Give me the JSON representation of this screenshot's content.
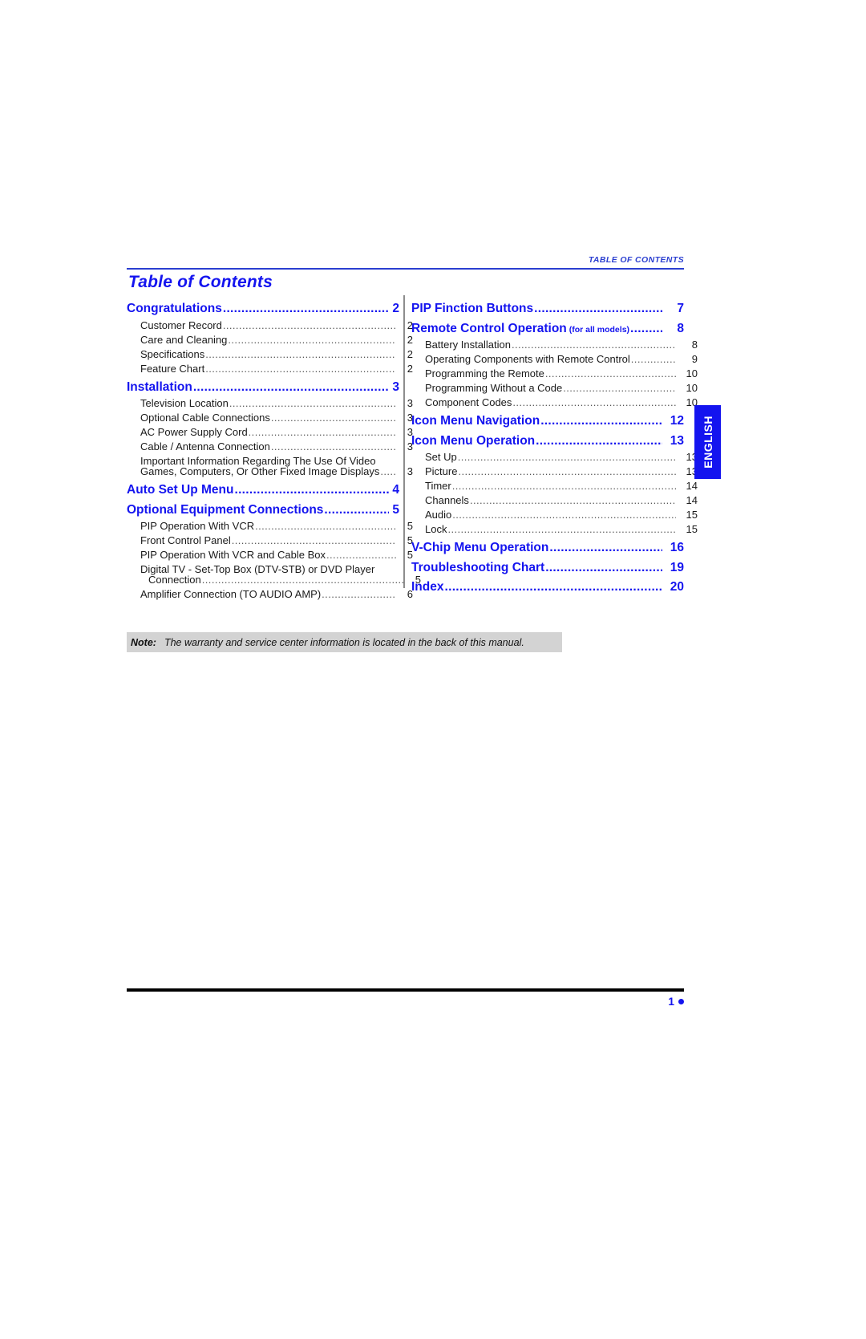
{
  "header": {
    "kicker_first": "T",
    "kicker_rest": "ABLE OF ",
    "kicker_c": "C",
    "kicker_tail": "ONTENTS",
    "kicker_full": "TABLE OF CONTENTS",
    "title": "Table of Contents"
  },
  "colors": {
    "heading_blue": "#1414ef",
    "kicker_blue": "#2b3fd0",
    "note_gray": "#d3d3d3",
    "divider_gray": "#8d8d8d",
    "footer_black": "#000000"
  },
  "left_column": [
    {
      "type": "major",
      "label": "Congratulations",
      "page": "2"
    },
    {
      "type": "minor",
      "label": "Customer Record",
      "page": "2"
    },
    {
      "type": "minor",
      "label": "Care and Cleaning",
      "page": "2"
    },
    {
      "type": "minor",
      "label": "Specifications",
      "page": "2"
    },
    {
      "type": "minor",
      "label": "Feature Chart",
      "page": "2"
    },
    {
      "type": "major",
      "label": "Installation",
      "page": "3"
    },
    {
      "type": "minor",
      "label": "Television Location",
      "page": "3"
    },
    {
      "type": "minor",
      "label": "Optional Cable Connections",
      "page": "3"
    },
    {
      "type": "minor",
      "label": "AC Power Supply Cord",
      "page": "3"
    },
    {
      "type": "minor",
      "label": "Cable / Antenna Connection",
      "page": "3"
    },
    {
      "type": "minor_wrap",
      "line1": "Important Information Regarding The Use Of Video",
      "line2": "Games, Computers, Or Other Fixed Image Displays",
      "page": "3",
      "indent2": false
    },
    {
      "type": "major",
      "label": "Auto Set Up Menu",
      "page": "4"
    },
    {
      "type": "major",
      "label": "Optional Equipment Connections",
      "page": "5"
    },
    {
      "type": "minor",
      "label": "PIP Operation With VCR",
      "page": "5"
    },
    {
      "type": "minor",
      "label": "Front Control Panel",
      "page": "5"
    },
    {
      "type": "minor",
      "label": "PIP Operation With VCR and Cable Box",
      "page": "5"
    },
    {
      "type": "minor_wrap",
      "line1": "Digital TV - Set-Top Box (DTV-STB) or DVD Player",
      "line2": "Connection",
      "page": "5",
      "indent2": true
    },
    {
      "type": "minor",
      "label": "Amplifier Connection (TO AUDIO AMP)",
      "page": "6"
    }
  ],
  "right_column": [
    {
      "type": "major",
      "label": "PIP Finction Buttons",
      "page": "7"
    },
    {
      "type": "major",
      "label": "Remote Control Operation",
      "qualifier": "(for all models)",
      "page": "8"
    },
    {
      "type": "minor",
      "label": "Battery Installation",
      "page": "8"
    },
    {
      "type": "minor",
      "label": "Operating Components with Remote Control",
      "page": "9"
    },
    {
      "type": "minor",
      "label": "Programming the Remote",
      "page": "10"
    },
    {
      "type": "minor",
      "label": "Programming Without a Code",
      "page": "10"
    },
    {
      "type": "minor",
      "label": "Component Codes",
      "page": "10"
    },
    {
      "type": "major",
      "label": "Icon Menu Navigation",
      "page": "12"
    },
    {
      "type": "major",
      "label": "Icon Menu Operation",
      "page": "13"
    },
    {
      "type": "minor",
      "label": "Set Up",
      "page": "13"
    },
    {
      "type": "minor",
      "label": "Picture",
      "page": "13"
    },
    {
      "type": "minor",
      "label": "Timer",
      "page": "14"
    },
    {
      "type": "minor",
      "label": "Channels",
      "page": "14"
    },
    {
      "type": "minor",
      "label": "Audio",
      "page": "15"
    },
    {
      "type": "minor",
      "label": "Lock",
      "page": "15"
    },
    {
      "type": "major",
      "label": "V-Chip Menu Operation",
      "page": "16"
    },
    {
      "type": "major",
      "label": "Troubleshooting Chart",
      "page": "19"
    },
    {
      "type": "major",
      "label": "Index",
      "page": "20"
    }
  ],
  "side_tab": {
    "label": "ENGLISH"
  },
  "note": {
    "label": "Note:",
    "text": "The warranty and service center information is located in the back of  this manual."
  },
  "footer": {
    "page_number": "1"
  },
  "dot_leader": "..............................................................................................................."
}
